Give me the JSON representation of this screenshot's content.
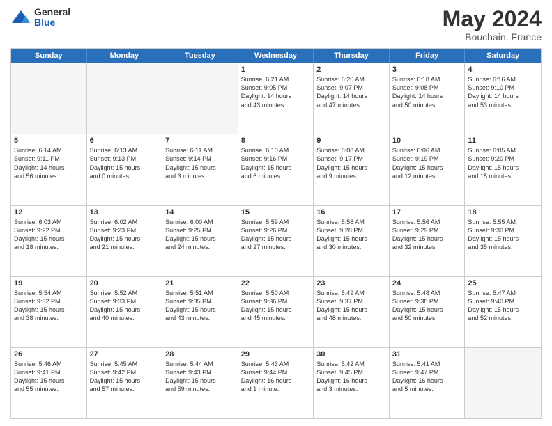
{
  "logo": {
    "general": "General",
    "blue": "Blue"
  },
  "title": {
    "month": "May 2024",
    "location": "Bouchain, France"
  },
  "header_days": [
    "Sunday",
    "Monday",
    "Tuesday",
    "Wednesday",
    "Thursday",
    "Friday",
    "Saturday"
  ],
  "rows": [
    [
      {
        "day": "",
        "text": "",
        "empty": true
      },
      {
        "day": "",
        "text": "",
        "empty": true
      },
      {
        "day": "",
        "text": "",
        "empty": true
      },
      {
        "day": "1",
        "text": "Sunrise: 6:21 AM\nSunset: 9:05 PM\nDaylight: 14 hours\nand 43 minutes."
      },
      {
        "day": "2",
        "text": "Sunrise: 6:20 AM\nSunset: 9:07 PM\nDaylight: 14 hours\nand 47 minutes."
      },
      {
        "day": "3",
        "text": "Sunrise: 6:18 AM\nSunset: 9:08 PM\nDaylight: 14 hours\nand 50 minutes."
      },
      {
        "day": "4",
        "text": "Sunrise: 6:16 AM\nSunset: 9:10 PM\nDaylight: 14 hours\nand 53 minutes."
      }
    ],
    [
      {
        "day": "5",
        "text": "Sunrise: 6:14 AM\nSunset: 9:11 PM\nDaylight: 14 hours\nand 56 minutes."
      },
      {
        "day": "6",
        "text": "Sunrise: 6:13 AM\nSunset: 9:13 PM\nDaylight: 15 hours\nand 0 minutes."
      },
      {
        "day": "7",
        "text": "Sunrise: 6:11 AM\nSunset: 9:14 PM\nDaylight: 15 hours\nand 3 minutes."
      },
      {
        "day": "8",
        "text": "Sunrise: 6:10 AM\nSunset: 9:16 PM\nDaylight: 15 hours\nand 6 minutes."
      },
      {
        "day": "9",
        "text": "Sunrise: 6:08 AM\nSunset: 9:17 PM\nDaylight: 15 hours\nand 9 minutes."
      },
      {
        "day": "10",
        "text": "Sunrise: 6:06 AM\nSunset: 9:19 PM\nDaylight: 15 hours\nand 12 minutes."
      },
      {
        "day": "11",
        "text": "Sunrise: 6:05 AM\nSunset: 9:20 PM\nDaylight: 15 hours\nand 15 minutes."
      }
    ],
    [
      {
        "day": "12",
        "text": "Sunrise: 6:03 AM\nSunset: 9:22 PM\nDaylight: 15 hours\nand 18 minutes."
      },
      {
        "day": "13",
        "text": "Sunrise: 6:02 AM\nSunset: 9:23 PM\nDaylight: 15 hours\nand 21 minutes."
      },
      {
        "day": "14",
        "text": "Sunrise: 6:00 AM\nSunset: 9:25 PM\nDaylight: 15 hours\nand 24 minutes."
      },
      {
        "day": "15",
        "text": "Sunrise: 5:59 AM\nSunset: 9:26 PM\nDaylight: 15 hours\nand 27 minutes."
      },
      {
        "day": "16",
        "text": "Sunrise: 5:58 AM\nSunset: 9:28 PM\nDaylight: 15 hours\nand 30 minutes."
      },
      {
        "day": "17",
        "text": "Sunrise: 5:56 AM\nSunset: 9:29 PM\nDaylight: 15 hours\nand 32 minutes."
      },
      {
        "day": "18",
        "text": "Sunrise: 5:55 AM\nSunset: 9:30 PM\nDaylight: 15 hours\nand 35 minutes."
      }
    ],
    [
      {
        "day": "19",
        "text": "Sunrise: 5:54 AM\nSunset: 9:32 PM\nDaylight: 15 hours\nand 38 minutes."
      },
      {
        "day": "20",
        "text": "Sunrise: 5:52 AM\nSunset: 9:33 PM\nDaylight: 15 hours\nand 40 minutes."
      },
      {
        "day": "21",
        "text": "Sunrise: 5:51 AM\nSunset: 9:35 PM\nDaylight: 15 hours\nand 43 minutes."
      },
      {
        "day": "22",
        "text": "Sunrise: 5:50 AM\nSunset: 9:36 PM\nDaylight: 15 hours\nand 45 minutes."
      },
      {
        "day": "23",
        "text": "Sunrise: 5:49 AM\nSunset: 9:37 PM\nDaylight: 15 hours\nand 48 minutes."
      },
      {
        "day": "24",
        "text": "Sunrise: 5:48 AM\nSunset: 9:38 PM\nDaylight: 15 hours\nand 50 minutes."
      },
      {
        "day": "25",
        "text": "Sunrise: 5:47 AM\nSunset: 9:40 PM\nDaylight: 15 hours\nand 52 minutes."
      }
    ],
    [
      {
        "day": "26",
        "text": "Sunrise: 5:46 AM\nSunset: 9:41 PM\nDaylight: 15 hours\nand 55 minutes."
      },
      {
        "day": "27",
        "text": "Sunrise: 5:45 AM\nSunset: 9:42 PM\nDaylight: 15 hours\nand 57 minutes."
      },
      {
        "day": "28",
        "text": "Sunrise: 5:44 AM\nSunset: 9:43 PM\nDaylight: 15 hours\nand 59 minutes."
      },
      {
        "day": "29",
        "text": "Sunrise: 5:43 AM\nSunset: 9:44 PM\nDaylight: 16 hours\nand 1 minute."
      },
      {
        "day": "30",
        "text": "Sunrise: 5:42 AM\nSunset: 9:45 PM\nDaylight: 16 hours\nand 3 minutes."
      },
      {
        "day": "31",
        "text": "Sunrise: 5:41 AM\nSunset: 9:47 PM\nDaylight: 16 hours\nand 5 minutes."
      },
      {
        "day": "",
        "text": "",
        "empty": true
      }
    ]
  ]
}
